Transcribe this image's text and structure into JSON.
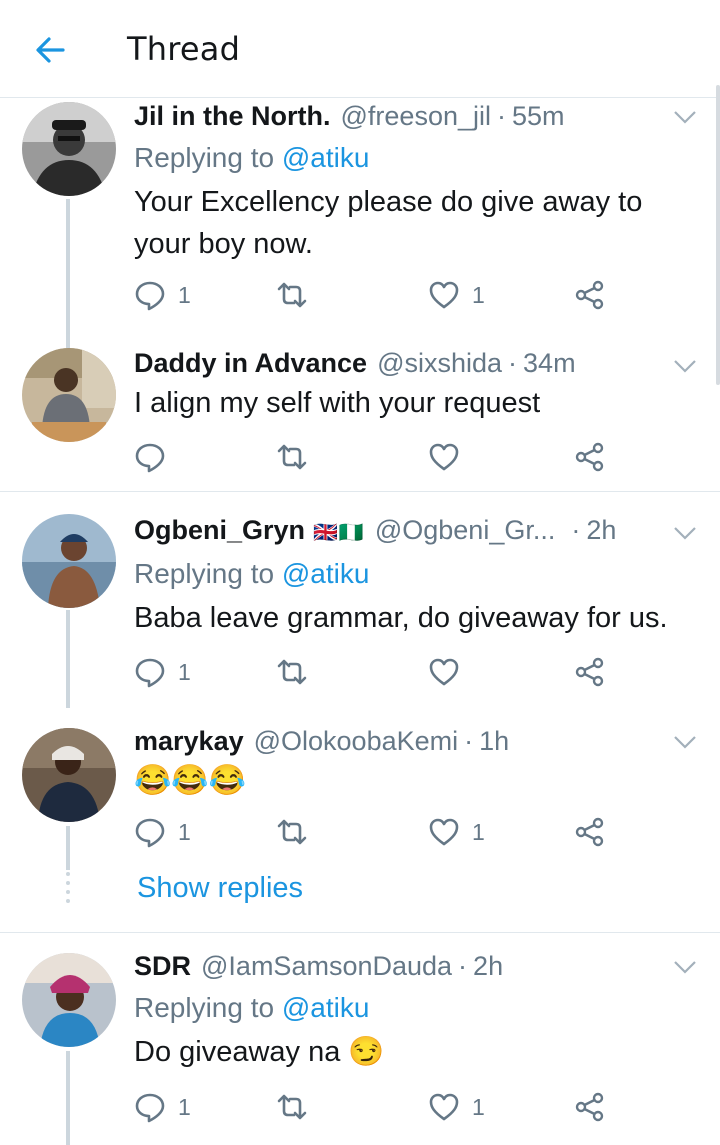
{
  "header": {
    "title": "Thread"
  },
  "tweets": [
    {
      "name": "Jil in the North.",
      "handle": "@freeson_jil",
      "time": "55m",
      "replying_prefix": "Replying to ",
      "replying_to": "@atiku",
      "text": "Your Excellency please do give away to your boy now.",
      "reply_count": "1",
      "retweet_count": "",
      "like_count": "1"
    },
    {
      "name": "Daddy in Advance",
      "handle": "@sixshida",
      "time": "34m",
      "text": "I align my self with your request",
      "reply_count": "",
      "retweet_count": "",
      "like_count": ""
    },
    {
      "name": "Ogbeni_Gryn",
      "flags": "🇬🇧🇳🇬",
      "handle": "@Ogbeni_Gr...",
      "time": "2h",
      "replying_prefix": "Replying to ",
      "replying_to": "@atiku",
      "text": "Baba leave grammar, do giveaway for us.",
      "reply_count": "1",
      "retweet_count": "",
      "like_count": ""
    },
    {
      "name": "marykay",
      "handle": "@OlokoobaKemi",
      "time": "1h",
      "text": "😂😂😂",
      "reply_count": "1",
      "retweet_count": "",
      "like_count": "1",
      "show_replies": "Show replies"
    },
    {
      "name": "SDR",
      "handle": "@IamSamsonDauda",
      "time": "2h",
      "replying_prefix": "Replying to ",
      "replying_to": "@atiku",
      "text": "Do giveaway na 😏",
      "reply_count": "1",
      "retweet_count": "",
      "like_count": "1"
    }
  ],
  "separator_dot": "·",
  "icons": {
    "back": "back-arrow-icon",
    "reply": "reply-icon",
    "retweet": "retweet-icon",
    "like": "heart-icon",
    "share": "share-icon",
    "more": "chevron-down-icon"
  },
  "colors": {
    "accent": "#1b95e0",
    "muted": "#657786",
    "text": "#14171a",
    "divider": "#e1e8ed"
  }
}
